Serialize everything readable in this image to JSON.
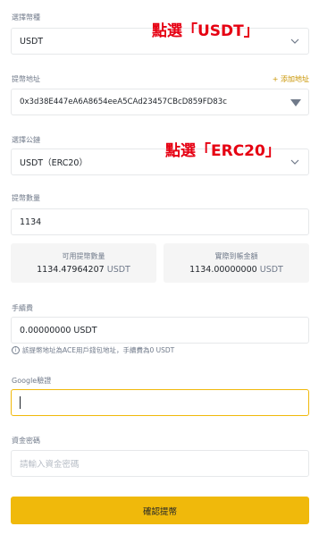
{
  "coin": {
    "label": "選擇幣種",
    "value": "USDT"
  },
  "annotation_coin": "點選「USDT」",
  "address": {
    "label": "提幣地址",
    "add_link": "+ 添加地址",
    "value": "0x3d38E447eA6A8654eeA5CAd23457CBcD859FD83c"
  },
  "network": {
    "label": "選擇公鏈",
    "value": "USDT（ERC20）"
  },
  "annotation_network": "點選「ERC20」",
  "amount": {
    "label": "提幣數量",
    "value": "1134"
  },
  "available": {
    "label": "可用提幣數量",
    "value": "1134.47964207",
    "unit": "USDT"
  },
  "received": {
    "label": "實際到帳金額",
    "value": "1134.00000000",
    "unit": "USDT"
  },
  "fee": {
    "label": "手續費",
    "value": "0.00000000 USDT"
  },
  "hint": "該提幣地址為ACE用戶錢包地址，手續費為0 USDT",
  "google": {
    "label": "Google驗證",
    "value": ""
  },
  "fund_password": {
    "label": "資金密碼",
    "placeholder": "請輸入資金密碼"
  },
  "submit_label": "確認提幣"
}
